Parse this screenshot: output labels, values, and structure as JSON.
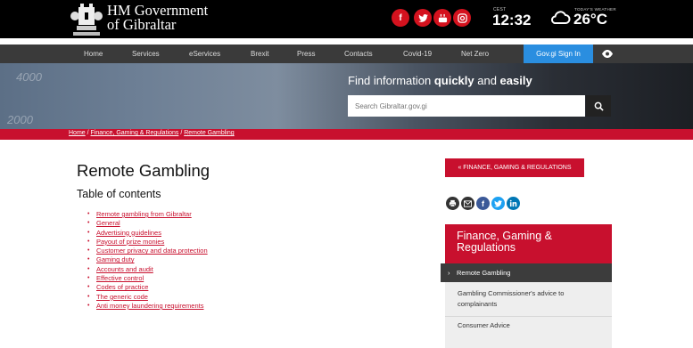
{
  "header": {
    "brand_line1": "HM Government",
    "brand_line2": "of Gibraltar",
    "social": [
      {
        "name": "facebook",
        "glyph": "f"
      },
      {
        "name": "twitter",
        "glyph": "t"
      },
      {
        "name": "youtube",
        "glyph": "▶"
      },
      {
        "name": "instagram",
        "glyph": "◎"
      }
    ],
    "clock_label": "CEST",
    "clock": "12:32",
    "weather_label": "TODAY'S WEATHER",
    "temperature": "26°C"
  },
  "nav": {
    "items": [
      "Home",
      "Services",
      "eServices",
      "Brexit",
      "Press",
      "Contacts",
      "Covid-19",
      "Net Zero"
    ],
    "signin": "Gov.gi Sign In"
  },
  "hero": {
    "bg_numbers": [
      "4000",
      "2000"
    ],
    "title_pre": "Find information ",
    "title_quick": "quickly",
    "title_mid": " and ",
    "title_easy": "easily",
    "search_placeholder": "Search Gibraltar.gov.gi"
  },
  "breadcrumb": {
    "items": [
      "Home",
      "Finance, Gaming & Regulations",
      "Remote Gambling"
    ],
    "sep": " / "
  },
  "main": {
    "title": "Remote Gambling",
    "toc_heading": "Table of contents",
    "toc": [
      "Remote gambling from Gibraltar",
      "General",
      "Advertising guidelines",
      "Payout of prize monies",
      "Customer privacy and data protection",
      "Gaming duty",
      "Accounts and audit",
      "Effective control",
      "Codes of practice",
      "The generic code",
      "Anti money laundering requirements"
    ]
  },
  "sidebar": {
    "back_label": "« FINANCE, GAMING & REGULATIONS",
    "panel_title": "Finance, Gaming & Regulations",
    "active_item": "Remote Gambling",
    "active_arrow": "›",
    "links": [
      "Gambling Commissioner's advice to complainants",
      "Consumer Advice"
    ]
  },
  "colors": {
    "brand_red": "#c8102e",
    "nav_bg": "#3a3a3a",
    "signin_blue": "#2a8ee0",
    "facebook_blue": "#3b5998",
    "twitter_blue": "#1da1f2",
    "linkedin_blue": "#0077b5"
  }
}
